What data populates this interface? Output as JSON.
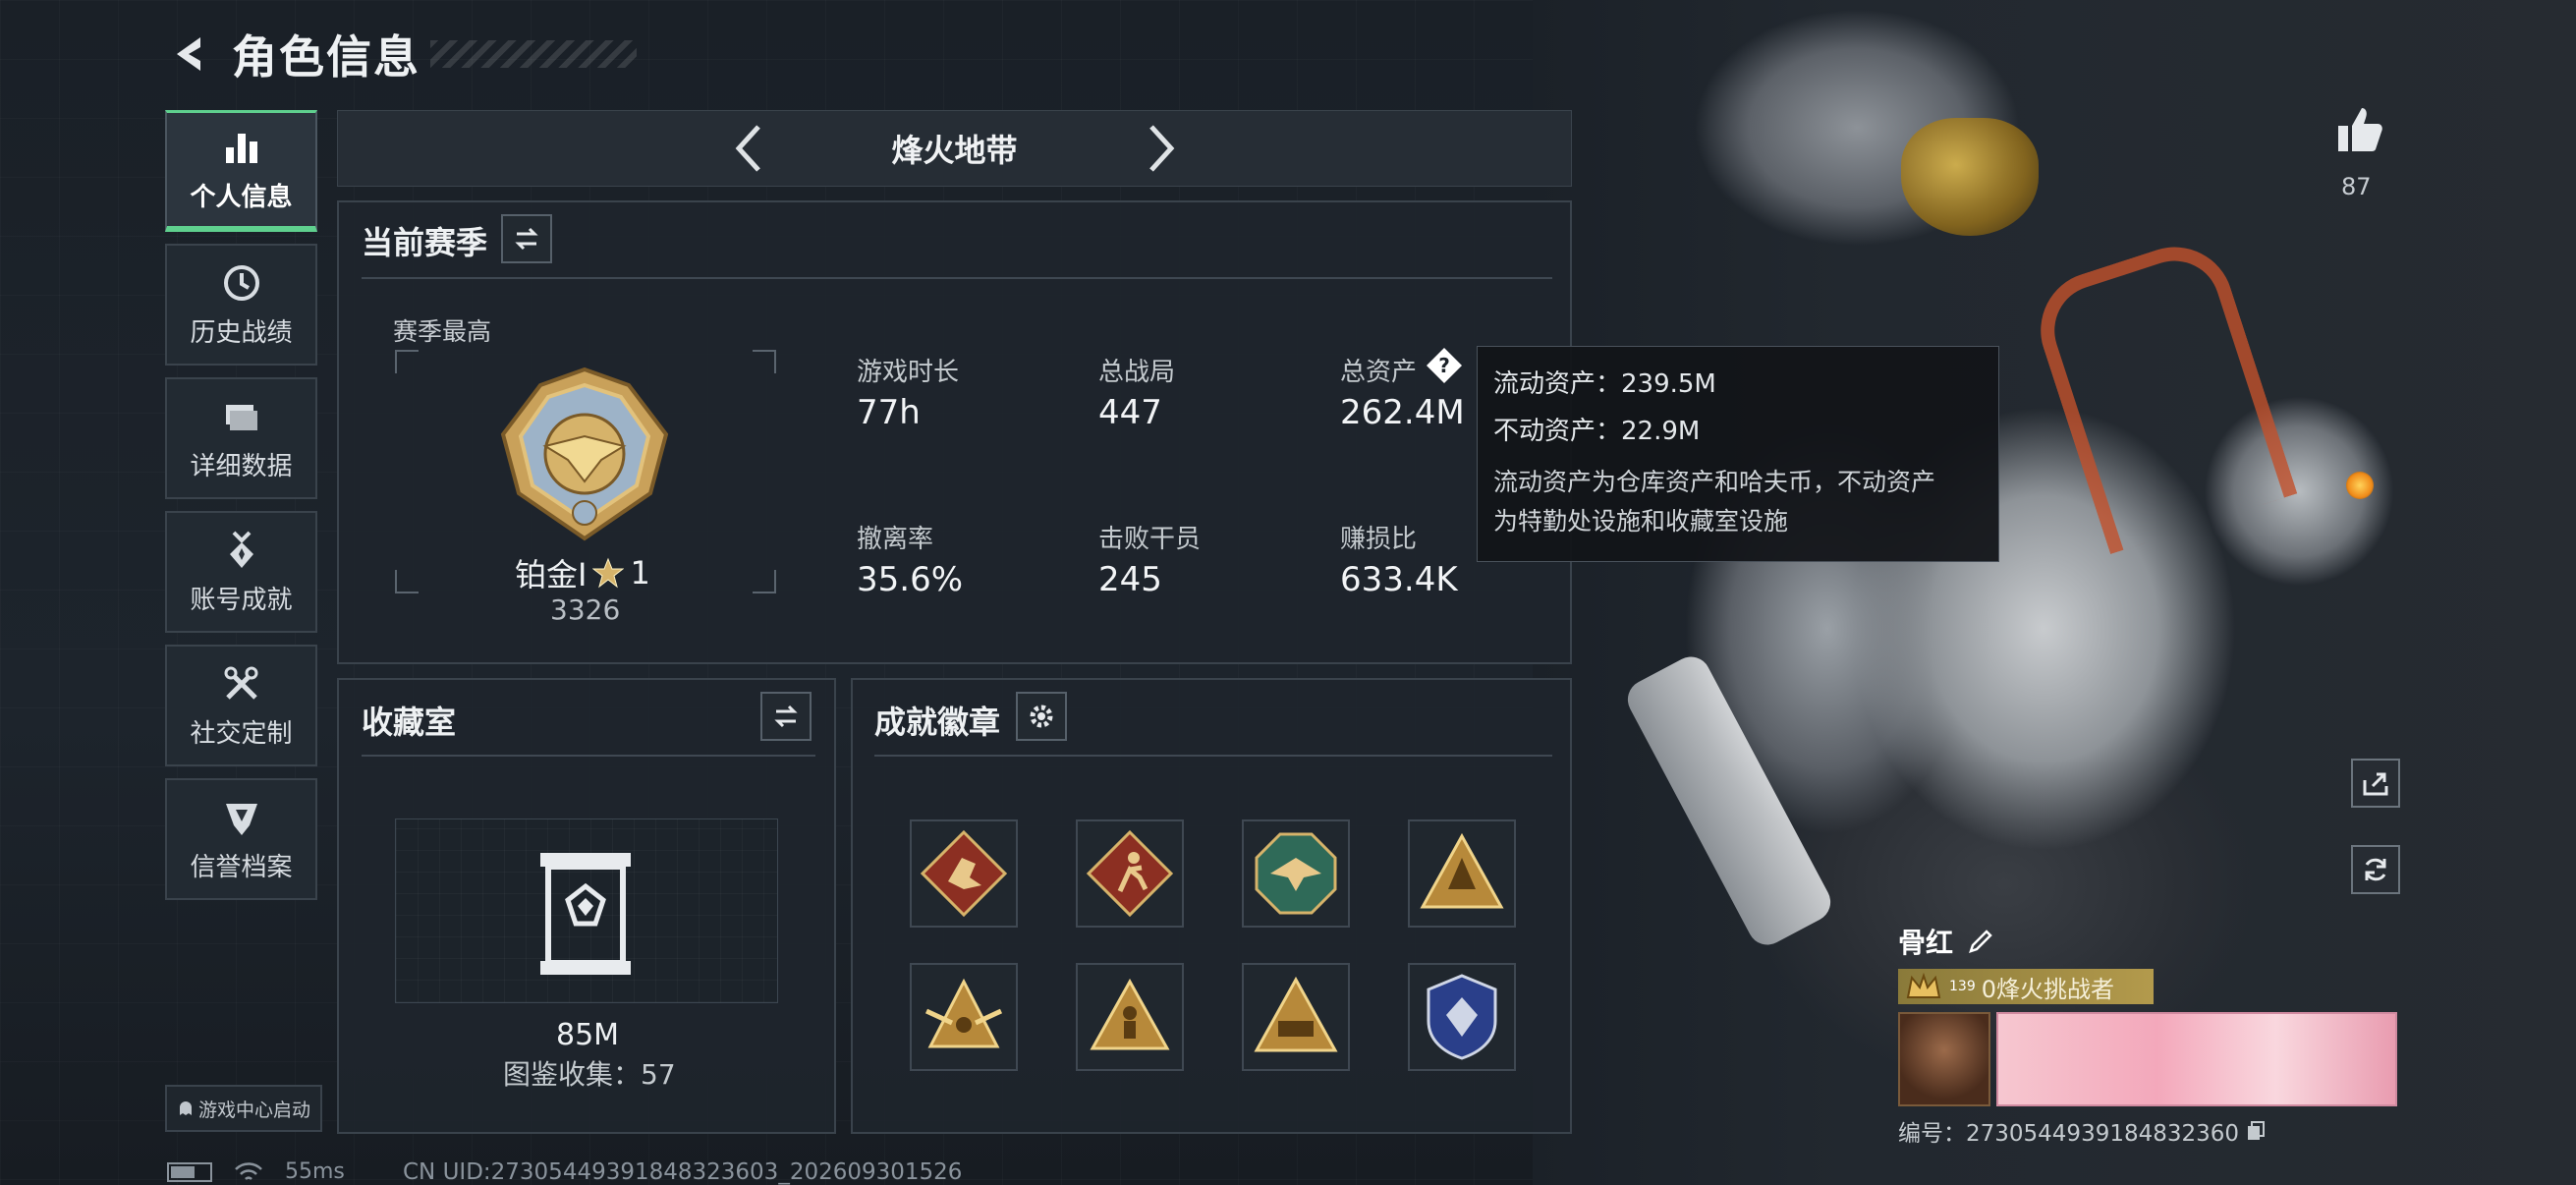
{
  "page": {
    "title": "角色信息"
  },
  "nav": {
    "items": [
      {
        "label": "个人信息",
        "icon": "bar-chart-icon",
        "active": true
      },
      {
        "label": "历史战绩",
        "icon": "clock-icon"
      },
      {
        "label": "详细数据",
        "icon": "folder-icon"
      },
      {
        "label": "账号成就",
        "icon": "medal-icon"
      },
      {
        "label": "社交定制",
        "icon": "tools-icon"
      },
      {
        "label": "信誉档案",
        "icon": "shield-icon"
      }
    ],
    "game_center": "游戏中心启动"
  },
  "mode": {
    "title": "烽火地带"
  },
  "season": {
    "title": "当前赛季",
    "best_label": "赛季最高",
    "rank_name": "铂金Ⅰ",
    "rank_stars": "1",
    "rank_score": "3326",
    "stats": [
      {
        "label": "游戏时长",
        "value": "77h"
      },
      {
        "label": "总战局",
        "value": "447"
      },
      {
        "label": "总资产",
        "value": "262.4M"
      },
      {
        "label": "撤离率",
        "value": "35.6%"
      },
      {
        "label": "击败干员",
        "value": "245"
      },
      {
        "label": "赚损比",
        "value": "633.4K"
      }
    ]
  },
  "tooltip": {
    "liquid": "流动资产：239.5M",
    "fixed": "不动资产：22.9M",
    "desc_1": "流动资产为仓库资产和哈夫币，不动资产",
    "desc_2": "为特勤处设施和收藏室设施"
  },
  "collection": {
    "title": "收藏室",
    "value": "85M",
    "count": "图鉴收集：57"
  },
  "achievements": {
    "title": "成就徽章",
    "badges": [
      "dragon-badge-icon",
      "runner-badge-icon",
      "eagle-badge-icon",
      "triangle-badge-icon",
      "winged-triangle-badge-icon",
      "soldier-triangle-badge-icon",
      "triangle-511-badge-icon",
      "blue-crest-badge-icon"
    ]
  },
  "social": {
    "likes": "87"
  },
  "player": {
    "name": "骨红",
    "level": "139",
    "title": "0烽火挑战者",
    "uid_label": "编号：2730544939184832360"
  },
  "status": {
    "ping": "55ms",
    "cn_uid": "CN UID:27305449391848323603_202609301526"
  }
}
